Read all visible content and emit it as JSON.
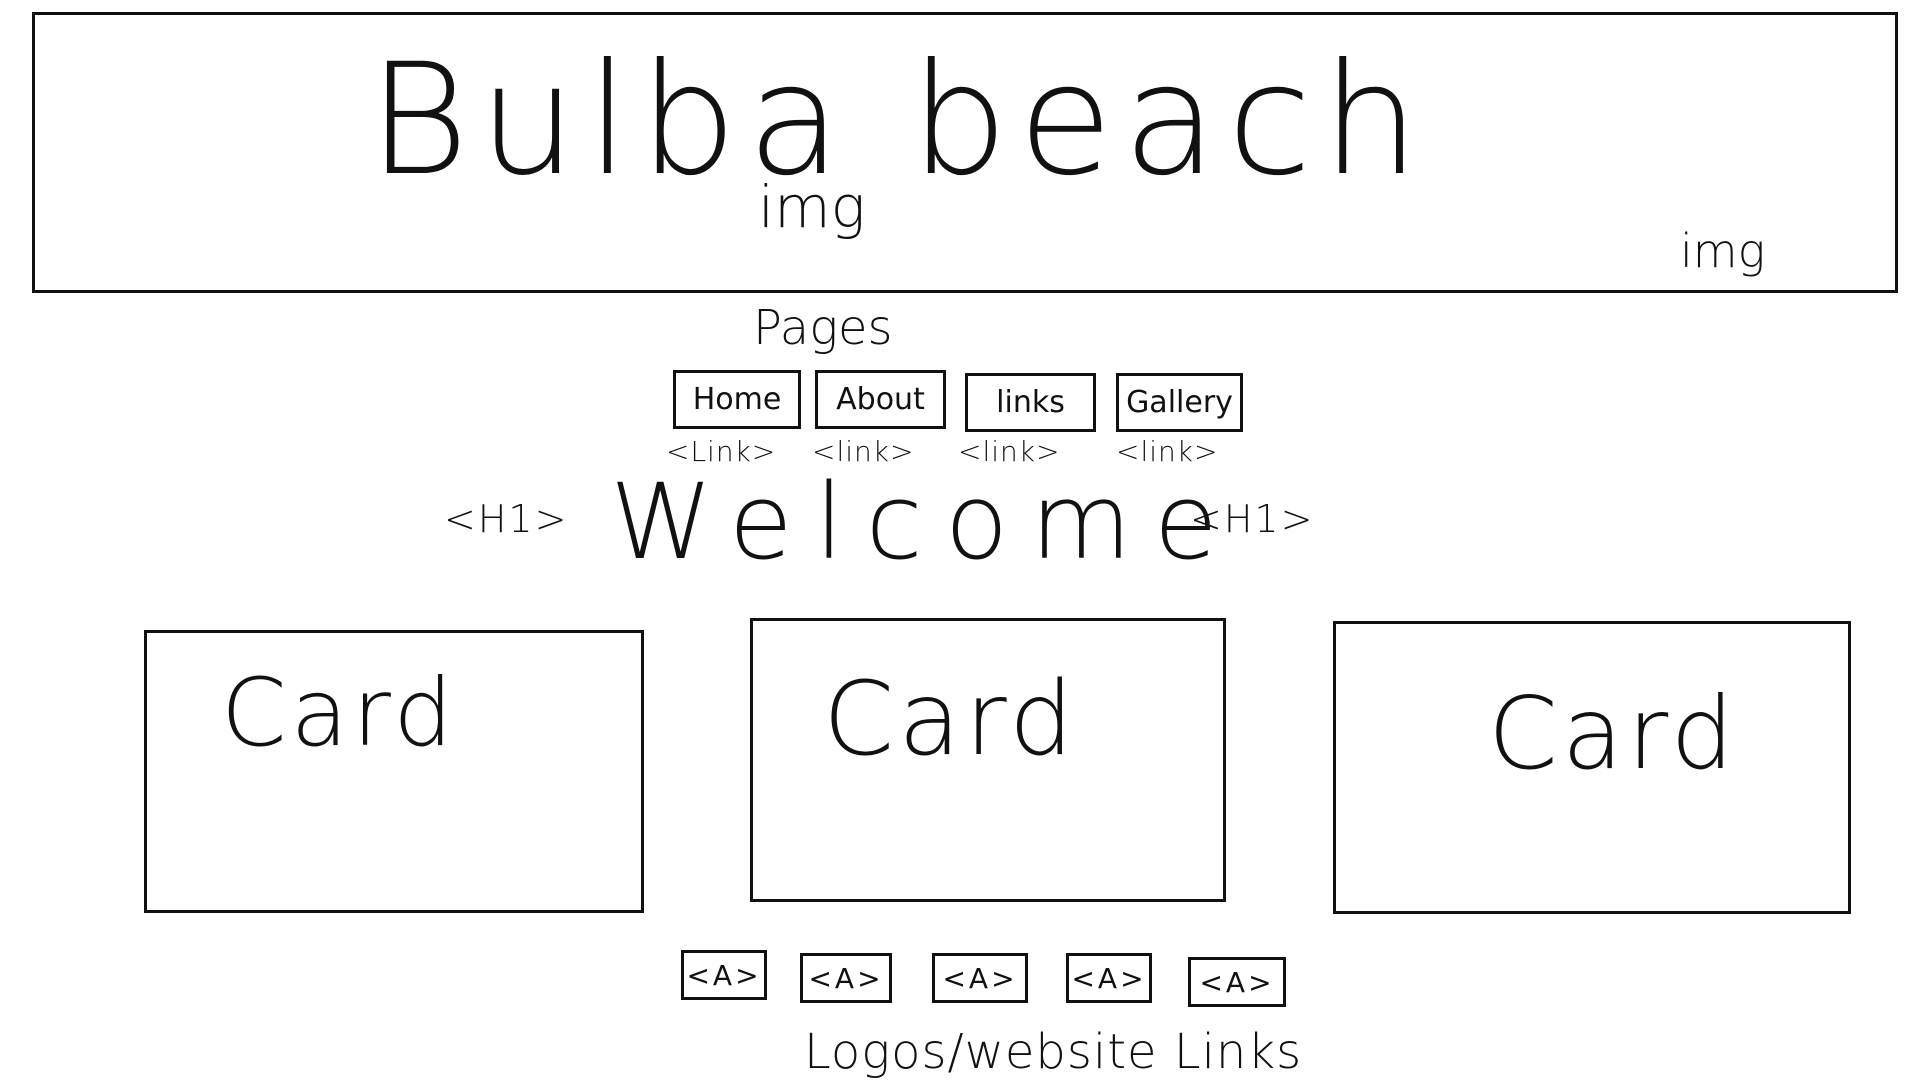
{
  "header": {
    "title": "Bulba beach",
    "img_label_center": "img",
    "img_label_right": "img"
  },
  "nav": {
    "heading": "Pages",
    "items": [
      {
        "label": "Home",
        "tag": "<Link>"
      },
      {
        "label": "About",
        "tag": "<link>"
      },
      {
        "label": "links",
        "tag": "<link>"
      },
      {
        "label": "Gallery",
        "tag": "<link>"
      }
    ]
  },
  "hero": {
    "tag_left": "<H1>",
    "welcome": "Welcome",
    "tag_right": "<H1>"
  },
  "cards": [
    {
      "title": "Card"
    },
    {
      "title": "Card"
    },
    {
      "title": "Card"
    }
  ],
  "footer": {
    "logo_buttons": [
      "<A>",
      "<A>",
      "<A>",
      "<A>",
      "<A>"
    ],
    "caption": "Logos/website Links"
  },
  "colors": {
    "ink": "#111111",
    "paper": "#ffffff"
  }
}
